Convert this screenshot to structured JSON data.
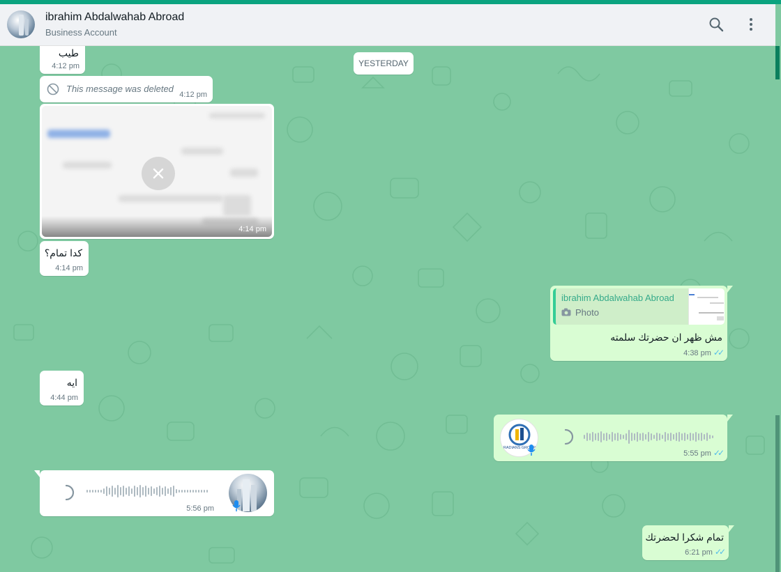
{
  "header": {
    "contact_name": "ibrahim Abdalwahab Abroad",
    "subtitle": "Business Account",
    "search_icon": "search-icon",
    "menu_icon": "kebab-menu-icon"
  },
  "colors": {
    "accent": "#0ba37f",
    "chat_bg": "#7fc9a1",
    "incoming": "#ffffff",
    "outgoing": "#d9fdd3",
    "read_ticks": "#53bdeb",
    "quote_name": "#35aa8a"
  },
  "date_divider": "YESTERDAY",
  "messages": [
    {
      "direction": "in",
      "text": "طيب",
      "time": "4:12 pm"
    },
    {
      "direction": "in",
      "type": "deleted",
      "text": "This message was deleted",
      "time": "4:12 pm",
      "icon": "ban-icon"
    },
    {
      "direction": "in",
      "type": "image",
      "time": "4:14 pm",
      "icon": "close-icon"
    },
    {
      "direction": "in",
      "text": "كدا تمام؟",
      "time": "4:14 pm"
    },
    {
      "direction": "out",
      "type": "reply",
      "quoted_name": "ibrahim Abdalwahab Abroad",
      "quoted_type": "Photo",
      "text": "مش ظهر ان حضرتك سلمته",
      "time": "4:38 pm",
      "status": "read"
    },
    {
      "direction": "in",
      "text": "ايه",
      "time": "4:44 pm"
    },
    {
      "direction": "out",
      "type": "voice",
      "time": "5:55 pm",
      "status": "read",
      "avatar_text": "RADIANS GROUP"
    },
    {
      "direction": "in",
      "type": "voice",
      "time": "5:56 pm"
    },
    {
      "direction": "out",
      "text": "تمام شكرا لحضرتك",
      "time": "6:21 pm",
      "status": "read"
    }
  ]
}
